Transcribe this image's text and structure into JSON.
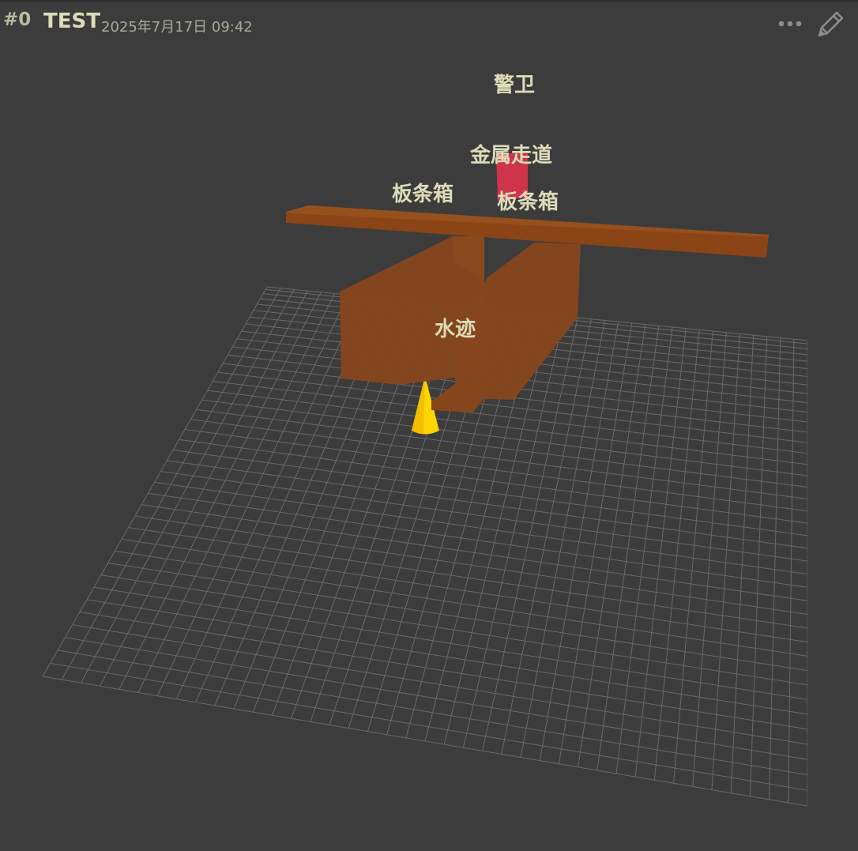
{
  "header": {
    "index": "#0",
    "title": "TEST",
    "date": "2025年7月17日 09:42",
    "more_icon": "more-horizontal-icon",
    "edit_icon": "pencil-icon"
  },
  "scene": {
    "labels": {
      "guard": "警卫",
      "metal_walkway": "金属走道",
      "crate_left": "板条箱",
      "crate_right": "板条箱",
      "water_mark": "水迹"
    },
    "colors": {
      "background": "#3c3c3c",
      "grid": "#6a6a6a",
      "crate": "#8a4416",
      "guard": "#d0344a",
      "player_cone": "#ffd400",
      "label": "#dcdcb8"
    }
  }
}
